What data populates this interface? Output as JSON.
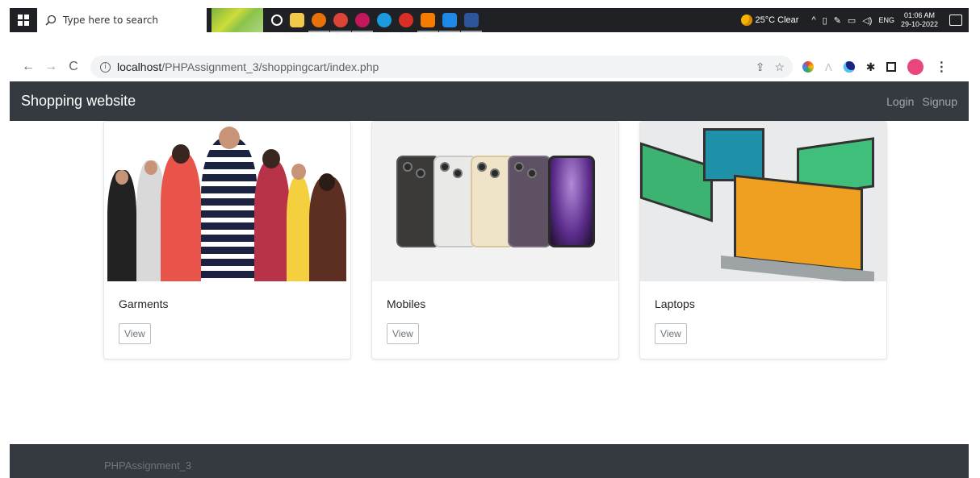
{
  "taskbar": {
    "search_placeholder": "Type here to search",
    "weather": "25°C  Clear",
    "language": "ENG",
    "time": "01:06 AM",
    "date": "29-10-2022"
  },
  "browser": {
    "url_host": "localhost",
    "url_path": "/PHPAssignment_3/shoppingcart/index.php"
  },
  "navbar": {
    "brand": "Shopping website",
    "login": "Login",
    "signup": "Signup"
  },
  "cards": [
    {
      "title": "Garments",
      "button": "View"
    },
    {
      "title": "Mobiles",
      "button": "View"
    },
    {
      "title": "Laptops",
      "button": "View"
    }
  ],
  "footer": {
    "text": "PHPAssignment_3"
  },
  "colors": {
    "navbar_bg": "#343a40",
    "footer_bg": "#343a40",
    "taskbar_bg": "#202124"
  }
}
